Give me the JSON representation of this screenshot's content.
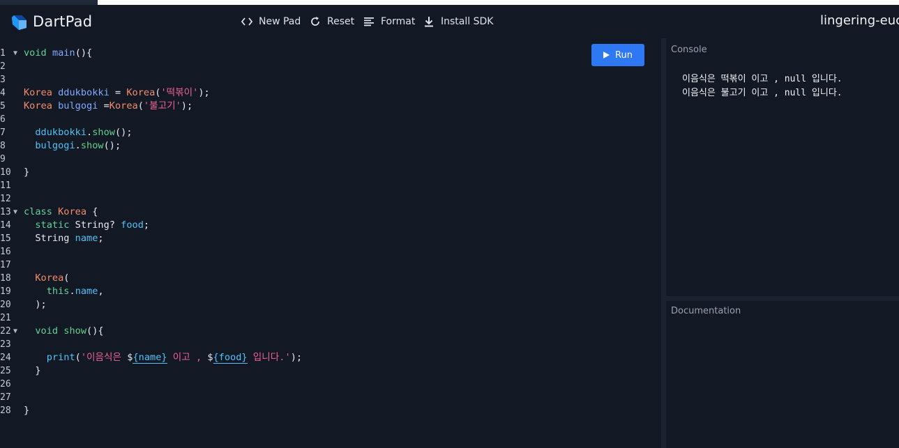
{
  "header": {
    "brand": "DartPad",
    "pad_name": "lingering-euca",
    "buttons": [
      {
        "label": "New Pad",
        "icon": "code-brackets-icon"
      },
      {
        "label": "Reset",
        "icon": "refresh-icon"
      },
      {
        "label": "Format",
        "icon": "format-align-icon"
      },
      {
        "label": "Install SDK",
        "icon": "download-icon"
      }
    ]
  },
  "editor": {
    "run_label": "Run",
    "line_numbers": [
      "1",
      "2",
      "3",
      "4",
      "5",
      "6",
      "7",
      "8",
      "9",
      "10",
      "11",
      "12",
      "13",
      "14",
      "15",
      "16",
      "17",
      "18",
      "19",
      "20",
      "21",
      "22",
      "23",
      "24",
      "25",
      "26",
      "27",
      "28"
    ],
    "fold_lines": [
      "1",
      "13",
      "22"
    ],
    "code": {
      "l1_kw": "void",
      "l1_fn": "main",
      "l1_rest": "(){",
      "l4_t1": "Korea",
      "l4_id": "ddukbokki",
      "l4_eq": " = ",
      "l4_t2": "Korea",
      "l4_p1": "(",
      "l4_str": "'떡볶이'",
      "l4_p2": ");",
      "l5_t1": "Korea",
      "l5_id": "bulgogi",
      "l5_eq": " =",
      "l5_t2": "Korea",
      "l5_p1": "(",
      "l5_str": "'불고기'",
      "l5_p2": ");",
      "l7_obj": "ddukbokki",
      "l7_dot": ".",
      "l7_m": "show",
      "l7_rest": "();",
      "l8_obj": "bulgogi",
      "l8_dot": ".",
      "l8_m": "show",
      "l8_rest": "();",
      "l10": "}",
      "l13_kw": "class",
      "l13_cls": "Korea",
      "l13_rest": " {",
      "l14_kw": "static",
      "l14_ty": " String? ",
      "l14_f": "food",
      "l14_rest": ";",
      "l15_ty": "String ",
      "l15_f": "name",
      "l15_rest": ";",
      "l18_cls": "Korea",
      "l18_rest": "(",
      "l19_kw": "this",
      "l19_dot": ".",
      "l19_f": "name",
      "l19_rest": ",",
      "l20": ");",
      "l22_kw": "void ",
      "l22_m": "show",
      "l22_rest": "(){",
      "l24_fn": "print",
      "l24_p1": "(",
      "l24_s1": "'이음식은 ",
      "l24_d1": "$",
      "l24_i1": "{name}",
      "l24_s2": " 이고 , ",
      "l24_d2": "$",
      "l24_i2": "{food}",
      "l24_s3": " 입니다.'",
      "l24_p2": ");",
      "l25": "}",
      "l28": "}"
    }
  },
  "console": {
    "title": "Console",
    "lines": [
      "이음식은 떡볶이 이고 , null 입니다.",
      "이음식은 불고기 이고 , null 입니다."
    ]
  },
  "documentation": {
    "title": "Documentation"
  },
  "colors": {
    "accent": "#2f78f3",
    "background": "#121824"
  }
}
